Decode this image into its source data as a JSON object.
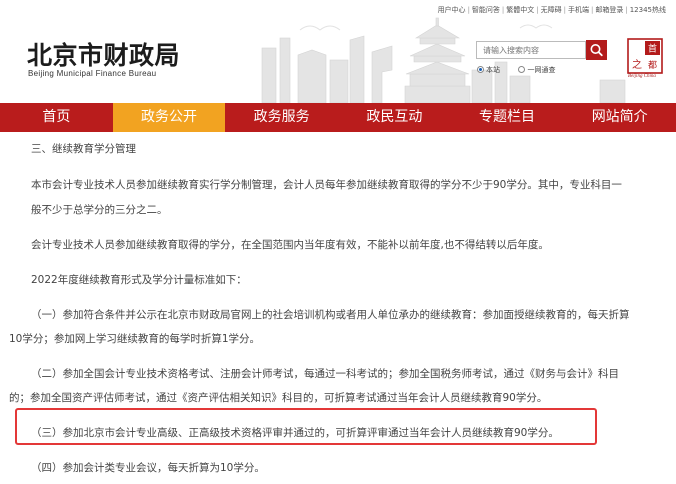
{
  "header": {
    "top_links": [
      "用户中心",
      "智能问答",
      "繁體中文",
      "无障碍",
      "手机端",
      "邮箱登录",
      "12345热线"
    ],
    "logo_cn": "北京市财政局",
    "logo_en": "Beijing Municipal Finance Bureau",
    "search_placeholder": "请输入搜索内容",
    "search_scopes": [
      "本站",
      "一网通查"
    ],
    "seal_text": "之首都",
    "seal_en": "Beijing China"
  },
  "nav": {
    "items": [
      "首页",
      "政务公开",
      "政务服务",
      "政民互动",
      "专题栏目",
      "网站简介"
    ],
    "active": "政务公开"
  },
  "article": {
    "section_title": "三、继续教育学分管理",
    "p1_line1": "本市会计专业技术人员参加继续教育实行学分制管理，会计人员每年参加继续教育取得的学分不少于90学分。其中，专业科目一",
    "p1_line2": "般不少于总学分的三分之二。",
    "p2": "会计专业技术人员参加继续教育取得的学分，在全国范围内当年度有效，不能补以前年度,也不得结转以后年度。",
    "p3": "2022年度继续教育形式及学分计量标准如下：",
    "item1_line1": "（一）参加符合条件并公示在北京市财政局官网上的社会培训机构或者用人单位承办的继续教育：参加面授继续教育的，每天折算",
    "item1_line2": "10学分；参加网上学习继续教育的每学时折算1学分。",
    "item2_line1": "（二）参加全国会计专业技术资格考试、注册会计师考试，每通过一科考试的；参加全国税务师考试，通过《财务与会计》科目",
    "item2_line2": "的；参加全国资产评估师考试，通过《资产评估相关知识》科目的，可折算考试通过当年会计人员继续教育90学分。",
    "item3": "（三）参加北京市会计专业高级、正高级技术资格评审并通过的，可折算评审通过当年会计人员继续教育90学分。",
    "item4": "（四）参加会计类专业会议，每天折算为10学分。"
  },
  "colors": {
    "nav_bg": "#b91c1c",
    "nav_active": "#f2a321",
    "highlight_border": "#e33838"
  }
}
